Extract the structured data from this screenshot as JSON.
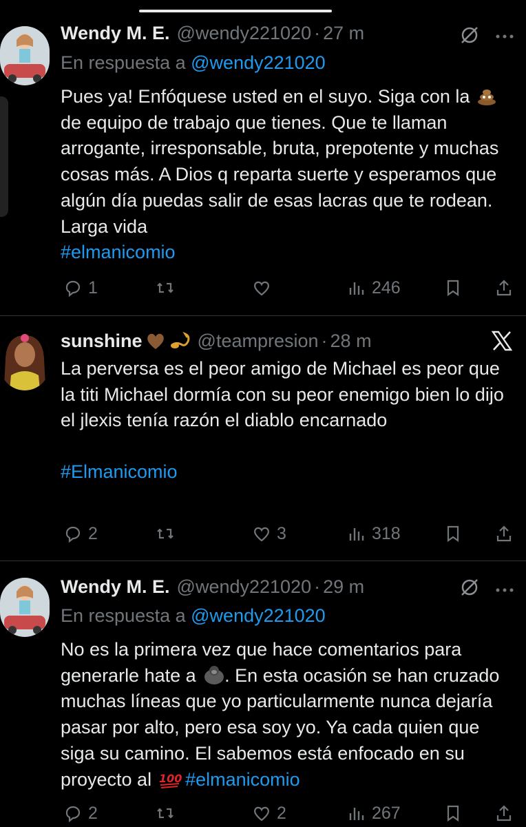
{
  "tweets": [
    {
      "name": "Wendy M. E.",
      "handle": "@wendy221020",
      "time": "27 m",
      "reply_prefix": "En respuesta a",
      "reply_mention": "@wendy221020",
      "text_line1": "Pues ya! Enfóquese usted en el suyo. Siga con la",
      "text_line2_after_emoji": "de equipo de trabajo que tienes. Que te llaman arrogante, irresponsable, bruta, prepotente y muchas cosas más. A Dios q reparta suerte y esperamos que algún día puedas salir de esas lacras que te rodean. Larga vida",
      "emoji": "poop-emoji",
      "hashtag": "#elmanicomio",
      "replies": "1",
      "retweets": "",
      "likes": "",
      "views": "246",
      "right_icon": "muted-icon",
      "avatar": "cartoon-avatar"
    },
    {
      "name": "sunshine",
      "name_emojis": [
        "brown-heart-emoji",
        "scorpion-emoji"
      ],
      "handle": "@teampresion",
      "time": "28 m",
      "text": "La perversa es el peor amigo de Michael es peor que la titi Michael dormía con su peor enemigo bien lo dijo el jlexis tenía razón el diablo encarnado",
      "hashtag": "#Elmanicomio",
      "replies": "2",
      "retweets": "",
      "likes": "3",
      "views": "318",
      "right_icon": "x-logo-icon",
      "avatar": "cartoon-avatar"
    },
    {
      "name": "Wendy M. E.",
      "handle": "@wendy221020",
      "time": "29 m",
      "reply_prefix": "En respuesta a",
      "reply_mention": "@wendy221020",
      "text_before_emoji": "No es la primera vez que hace comentarios para generarle hate a",
      "text_after_emoji": ". En esta ocasión se han cruzado muchas líneas que yo particularmente nunca dejaría pasar por alto, pero esa soy yo. Ya cada quien que siga su camino. El sabemos está enfocado en su proyecto al",
      "emojis": [
        "gorilla-emoji",
        "hundred-points-emoji"
      ],
      "hashtag": "#elmanicomio",
      "replies": "2",
      "retweets": "",
      "likes": "2",
      "views": "267",
      "right_icon": "muted-icon",
      "avatar": "cartoon-avatar"
    }
  ],
  "separator": "·",
  "colors": {
    "background": "#000000",
    "text": "#e7e9ea",
    "muted": "#71767b",
    "link": "#1d9bf0",
    "divider": "#2f3336"
  }
}
